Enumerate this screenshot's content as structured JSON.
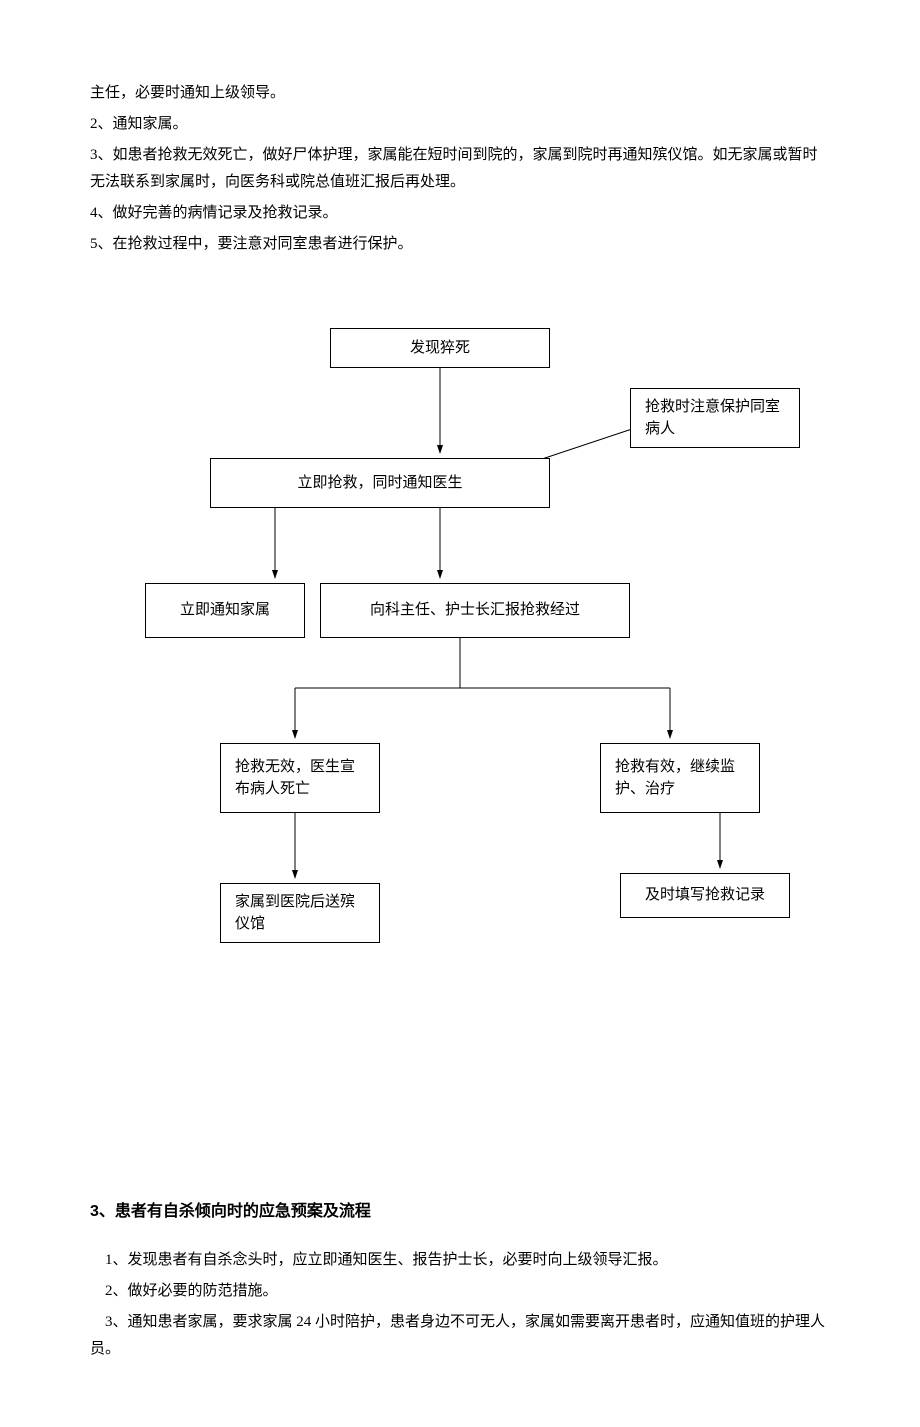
{
  "top_paragraphs": {
    "p1": "主任，必要时通知上级领导。",
    "p2": "2、通知家属。",
    "p3": "3、如患者抢救无效死亡，做好尸体护理，家属能在短时间到院的，家属到院时再通知殡仪馆。如无家属或暂时无法联系到家属时，向医务科或院总值班汇报后再处理。",
    "p4": "4、做好完善的病情记录及抢救记录。",
    "p5": "5、在抢救过程中，要注意对同室患者进行保护。"
  },
  "flowchart": {
    "n1": "发现猝死",
    "n2": "立即抢救，同时通知医生",
    "n2_side": "抢救时注意保护同室病人",
    "n3_left": "立即通知家属",
    "n3_right": "向科主任、护士长汇报抢救经过",
    "n4_left": "抢救无效，医生宣布病人死亡",
    "n4_right": "抢救有效，继续监护、治疗",
    "n5_left": "家属到医院后送殡仪馆",
    "n5_right": "及时填写抢救记录"
  },
  "section_title": "3、患者有自杀倾向时的应急预案及流程",
  "body": {
    "b1": "1、发现患者有自杀念头时，应立即通知医生、报告护士长，必要时向上级领导汇报。",
    "b2": "2、做好必要的防范措施。",
    "b3": "3、通知患者家属，要求家属 24 小时陪护，患者身边不可无人，家属如需要离开患者时，应通知值班的护理人员。"
  }
}
